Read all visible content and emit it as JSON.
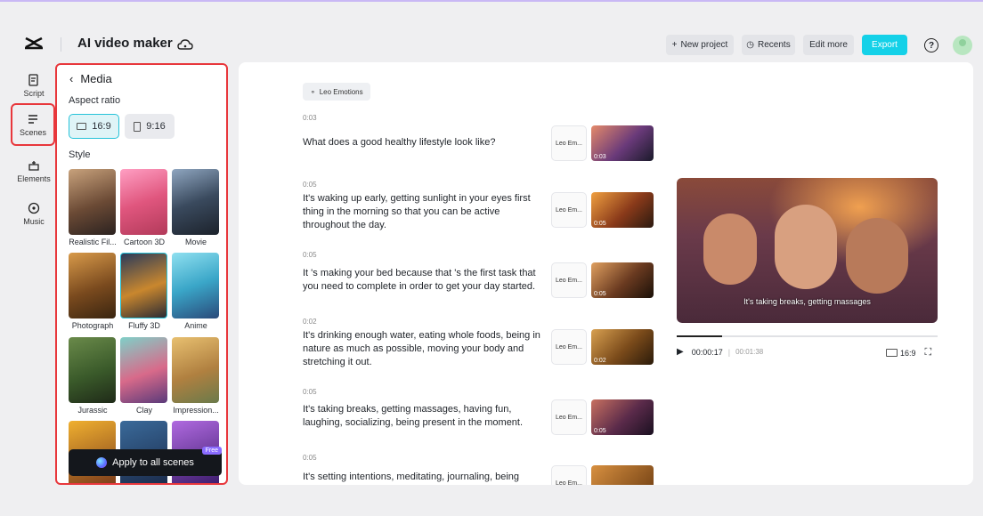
{
  "header": {
    "app_title": "AI video maker",
    "new_project": "New project",
    "recents": "Recents",
    "edit_more": "Edit more",
    "export": "Export",
    "help": "?"
  },
  "rail": {
    "script": "Script",
    "scenes": "Scenes",
    "elements": "Elements",
    "music": "Music"
  },
  "panel": {
    "title": "Media",
    "aspect_ratio_label": "Aspect ratio",
    "ratio_169": "16:9",
    "ratio_916": "9:16",
    "style_label": "Style",
    "styles": [
      "Realistic Fil...",
      "Cartoon 3D",
      "Movie",
      "Photograph",
      "Fluffy 3D",
      "Anime",
      "Jurassic",
      "Clay",
      "Impression..."
    ],
    "apply": "Apply to all scenes",
    "free": "Free"
  },
  "main": {
    "voice_chip": "Leo Emotions",
    "scenes": [
      {
        "dur": "0:03",
        "text": "What does a good healthy lifestyle look like?",
        "voice": "Leo Em...",
        "clip": "0:03"
      },
      {
        "dur": "0:05",
        "text": "It's waking up early, getting sunlight in your eyes first thing in the morning so that you can be active throughout the day.",
        "voice": "Leo Em...",
        "clip": "0:05"
      },
      {
        "dur": "0:05",
        "text": "It 's making your bed because that 's the first task that you need to complete in order to get your day started.",
        "voice": "Leo Em...",
        "clip": "0:05"
      },
      {
        "dur": "0:02",
        "text": "It's drinking enough water, eating whole foods, being in nature as much as possible, moving your body and stretching it out.",
        "voice": "Leo Em...",
        "clip": "0:02"
      },
      {
        "dur": "0:05",
        "text": "It's taking breaks, getting massages, having fun, laughing, socializing, being present in the moment.",
        "voice": "Leo Em...",
        "clip": "0:05"
      },
      {
        "dur": "0:05",
        "text": "It's setting intentions, meditating, journaling, being",
        "voice": "Leo Em...",
        "clip": ""
      }
    ]
  },
  "player": {
    "caption": "It's taking breaks, getting massages",
    "current": "00:00:17",
    "total": "00:01:38",
    "ratio": "16:9",
    "progress": 0.175
  },
  "colors": {
    "accent": "#14d1e8",
    "highlight": "#e8373c"
  }
}
